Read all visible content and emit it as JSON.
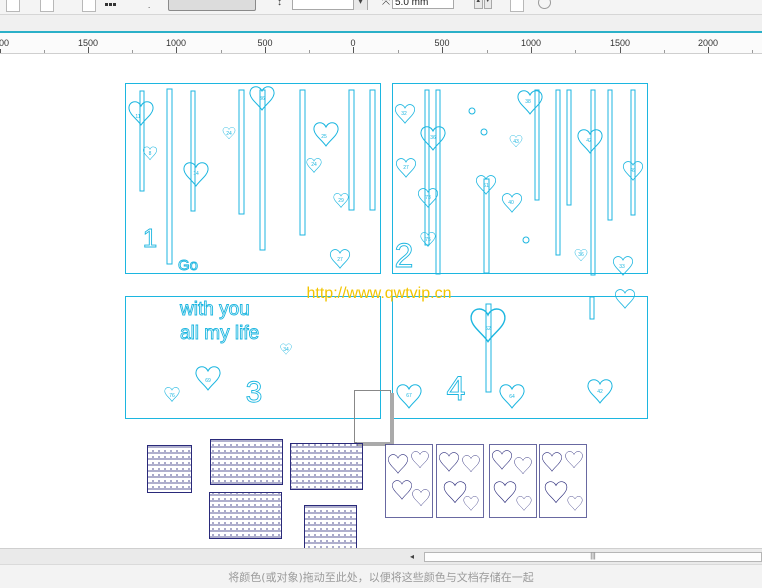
{
  "toolbar": {
    "nudge_value": "5.0 mm",
    "icons": [
      "page-icon",
      "grid-icon",
      "text-icon",
      "nudge-icon",
      "duplicate-icon",
      "info-icon"
    ]
  },
  "ruler": {
    "labels": [
      "00",
      "1500",
      "1000",
      "500",
      "0",
      "500",
      "1000",
      "1500",
      "2000"
    ]
  },
  "canvas": {
    "panel1": {
      "number": "1",
      "word": "Go"
    },
    "panel2": {
      "number": "2"
    },
    "panel3": {
      "number": "3",
      "line1": "with you",
      "line2": "all my life"
    },
    "panel4": {
      "number": "4"
    },
    "watermark": "http://www.qwtvip.cn",
    "hearts": [
      "11",
      "8",
      "14",
      "36",
      "24",
      "25",
      "24",
      "29",
      "27",
      "32",
      "36",
      "27",
      "73",
      "75",
      "38",
      "61",
      "42",
      "49",
      "40",
      "43",
      "36",
      "33",
      "42",
      "69",
      "76",
      "62",
      "34",
      "67",
      "64",
      "59"
    ]
  },
  "scrollbar": {
    "thumb_glyph": "|||"
  },
  "status": {
    "message": "将颜色(或对象)拖动至此处，以便将这些颜色与文档存储在一起"
  },
  "colors": {
    "accent": "#2bb0c8",
    "outline": "#1cb6e0",
    "nested": "#2a2a7a",
    "watermark": "#f2c400"
  }
}
